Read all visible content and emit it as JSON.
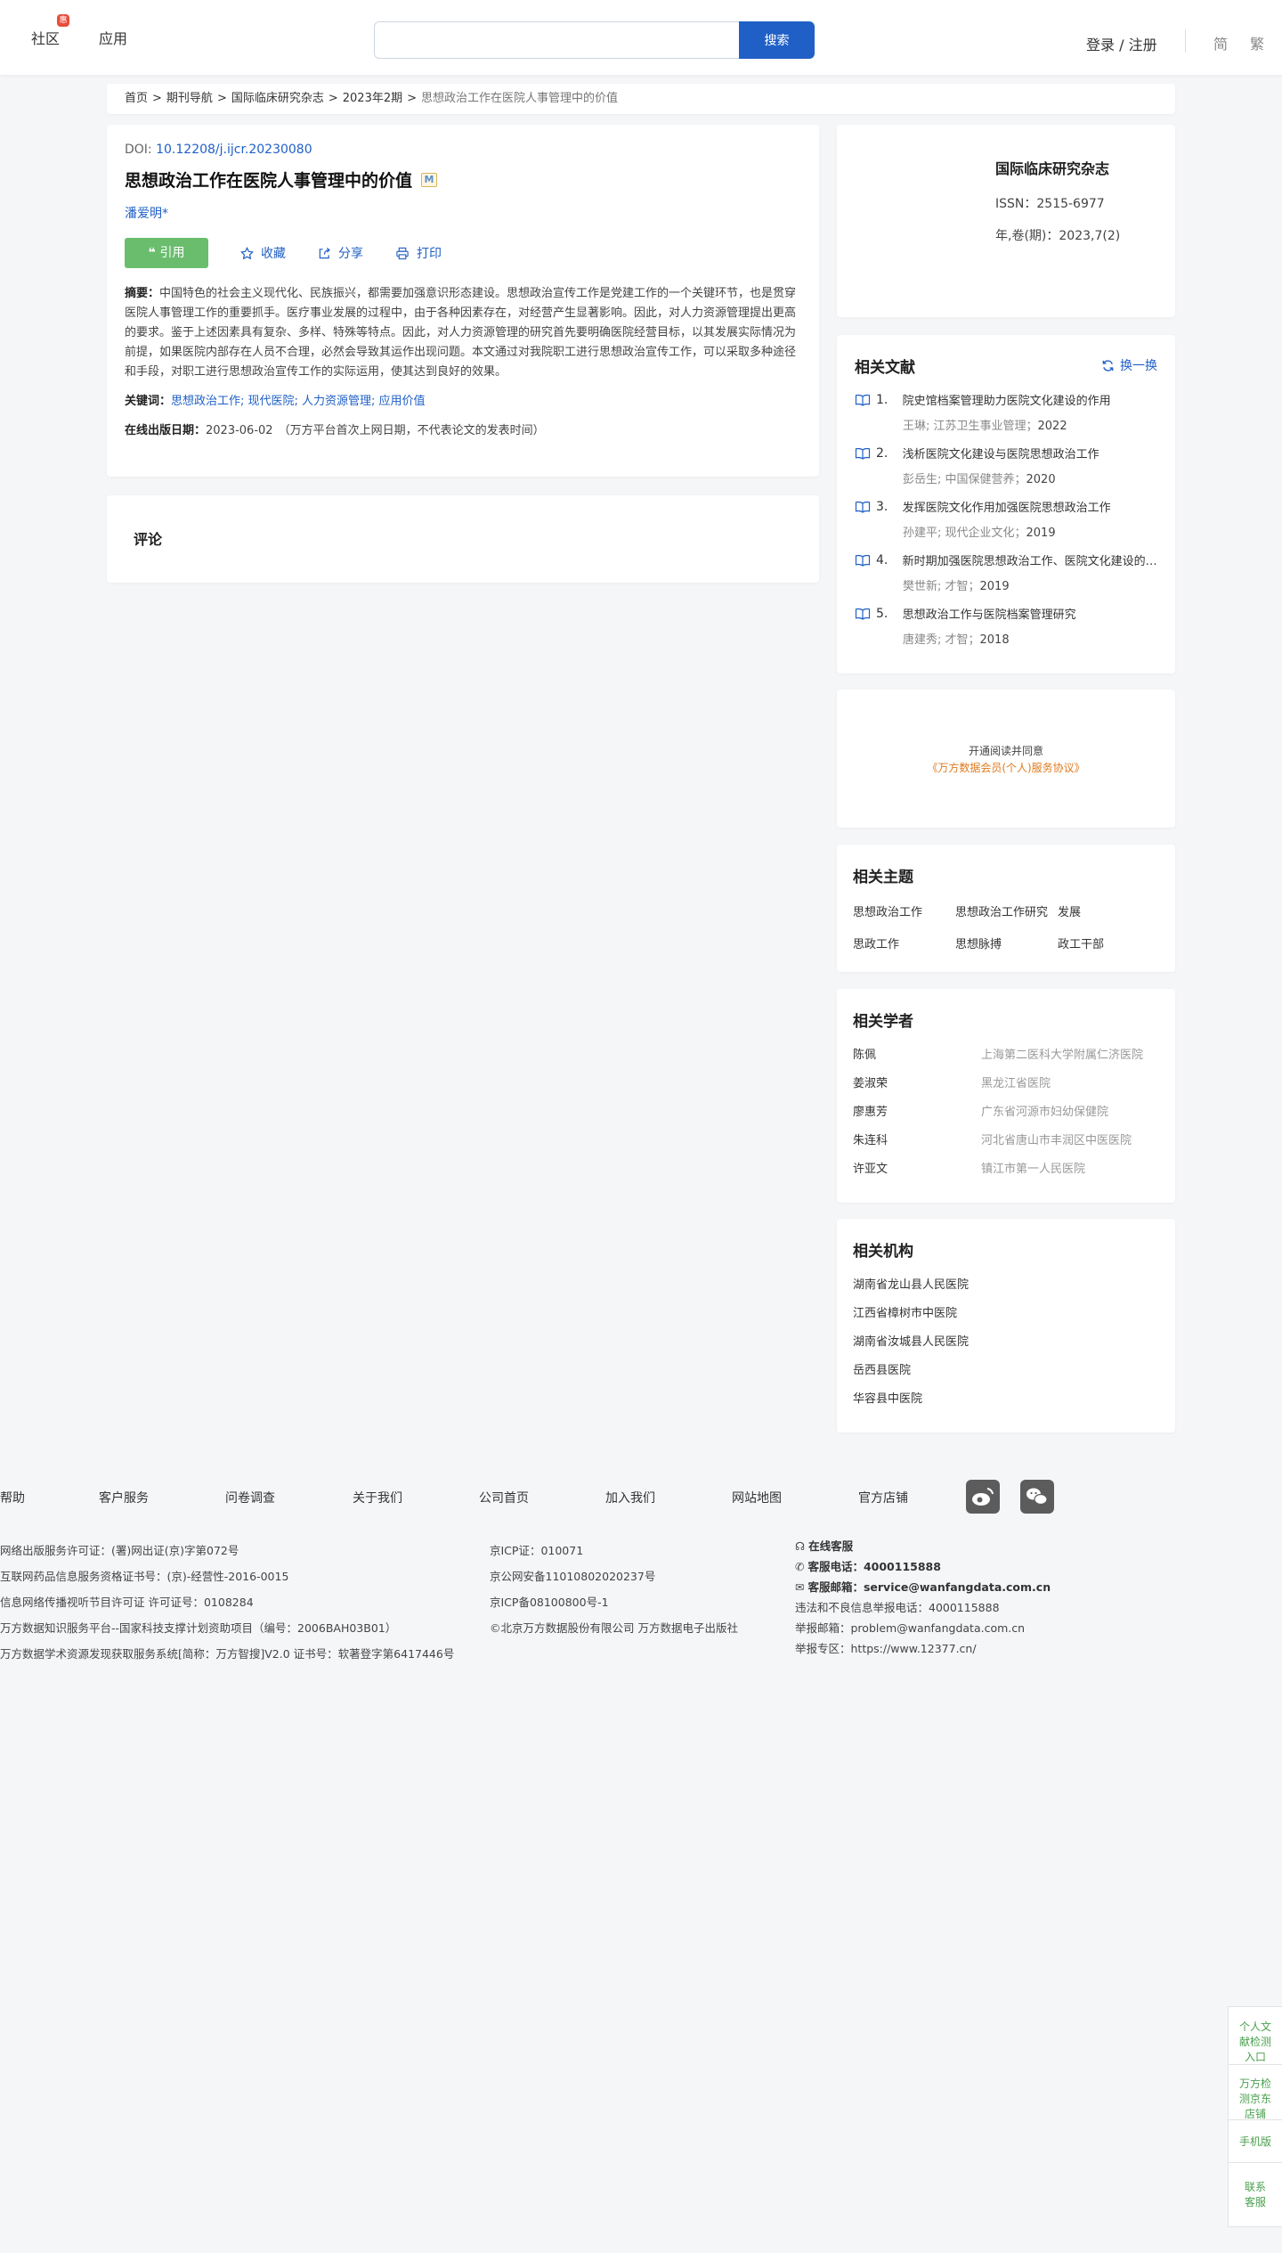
{
  "header": {
    "nav": [
      "社区",
      "应用"
    ],
    "badge": "惠",
    "search_placeholder": "",
    "search_button": "搜索",
    "login": "登录 / 注册",
    "lang_simplified": "简",
    "lang_traditional": "繁"
  },
  "breadcrumb": [
    "首页",
    "期刊导航",
    "国际临床研究杂志",
    "2023年2期",
    "思想政治工作在医院人事管理中的价值"
  ],
  "article": {
    "doi_label": "DOI: ",
    "doi": "10.12208/j.ijcr.20230080",
    "title": "思想政治工作在医院人事管理中的价值",
    "m_badge": "M",
    "author": "潘爱明*",
    "cite": "引用",
    "favorite": "收藏",
    "share": "分享",
    "print": "打印",
    "abstract_label": "摘要：",
    "abstract": "中国特色的社会主义现代化、民族振兴，都需要加强意识形态建设。思想政治宣传工作是党建工作的一个关键环节，也是贯穿医院人事管理工作的重要抓手。医疗事业发展的过程中，由于各种因素存在，对经营产生显著影响。因此，对人力资源管理提出更高的要求。鉴于上述因素具有复杂、多样、特殊等特点。因此，对人力资源管理的研究首先要明确医院经营目标，以其发展实际情况为前提，如果医院内部存在人员不合理，必然会导致其运作出现问题。本文通过对我院职工进行思想政治宣传工作，可以采取多种途径和手段，对职工进行思想政治宣传工作的实际运用，使其达到良好的效果。",
    "keywords_label": "关键词：",
    "keywords": "思想政治工作; 现代医院; 人力资源管理; 应用价值",
    "pubdate_label": "在线出版日期：",
    "pubdate": "2023-06-02",
    "pubdate_note": "（万方平台首次上网日期，不代表论文的发表时间）"
  },
  "comment": {
    "title": "评论"
  },
  "journal": {
    "name": "国际临床研究杂志",
    "issn": "ISSN：2515-6977",
    "issue": "年,卷(期)：2023,7(2)"
  },
  "related": {
    "title": "相关文献",
    "swap": "换一换",
    "items": [
      {
        "num": "1.",
        "title": "院史馆档案管理助力医院文化建设的作用",
        "meta": "王琳; 江苏卫生事业管理；",
        "year": "2022"
      },
      {
        "num": "2.",
        "title": "浅析医院文化建设与医院思想政治工作",
        "meta": "彭岳生; 中国保健营养；",
        "year": "2020"
      },
      {
        "num": "3.",
        "title": "发挥医院文化作用加强医院思想政治工作",
        "meta": "孙建平; 现代企业文化；",
        "year": "2019"
      },
      {
        "num": "4.",
        "title": "新时期加强医院思想政治工作、医院文化建设的研究",
        "meta": "樊世新; 才智；",
        "year": "2019"
      },
      {
        "num": "5.",
        "title": "思想政治工作与医院档案管理研究",
        "meta": "唐建秀; 才智；",
        "year": "2018"
      }
    ]
  },
  "agreement": {
    "line1": "开通阅读并同意",
    "link": "《万方数据会员(个人)服务协议》"
  },
  "topics": {
    "title": "相关主题",
    "items": [
      "思想政治工作",
      "思想政治工作研究",
      "发展",
      "思政工作",
      "思想脉搏",
      "政工干部"
    ]
  },
  "scholars": {
    "title": "相关学者",
    "items": [
      {
        "name": "陈佩",
        "org": "上海第二医科大学附属仁济医院"
      },
      {
        "name": "姜淑荣",
        "org": "黑龙江省医院"
      },
      {
        "name": "廖惠芳",
        "org": "广东省河源市妇幼保健院"
      },
      {
        "name": "朱连科",
        "org": "河北省唐山市丰润区中医医院"
      },
      {
        "name": "许亚文",
        "org": "镇江市第一人民医院"
      }
    ]
  },
  "institutions": {
    "title": "相关机构",
    "items": [
      "湖南省龙山县人民医院",
      "江西省樟树市中医院",
      "湖南省汝城县人民医院",
      "岳西县医院",
      "华容县中医院"
    ]
  },
  "footer": {
    "links": [
      "帮助",
      "客户服务",
      "问卷调查",
      "关于我们",
      "公司首页",
      "加入我们",
      "网站地图",
      "官方店铺"
    ],
    "col1": [
      "网络出版服务许可证：(署)网出证(京)字第072号",
      "互联网药品信息服务资格证书号：(京)-经营性-2016-0015",
      "信息网络传播视听节目许可证 许可证号：0108284",
      "万方数据知识服务平台--国家科技支撑计划资助项目（编号：2006BAH03B01）",
      "万方数据学术资源发现获取服务系统[简称：万方智搜]V2.0 证书号：软著登字第6417446号"
    ],
    "col2": [
      "京ICP证：010071",
      "京公网安备11010802020237号",
      "京ICP备08100800号-1",
      "©北京万方数据股份有限公司 万方数据电子出版社"
    ],
    "online_service": "在线客服",
    "phone_label": "客服电话：",
    "phone": "4000115888",
    "email_label": "客服邮箱：",
    "email": "service@wanfangdata.com.cn",
    "report_phone": "违法和不良信息举报电话：4000115888",
    "report_email": "举报邮箱：problem@wanfangdata.com.cn",
    "report_site": "举报专区：https://www.12377.cn/"
  },
  "float_tools": [
    "个人文献检测入口",
    "万方检测京东店铺",
    "手机版",
    "联系客服"
  ]
}
